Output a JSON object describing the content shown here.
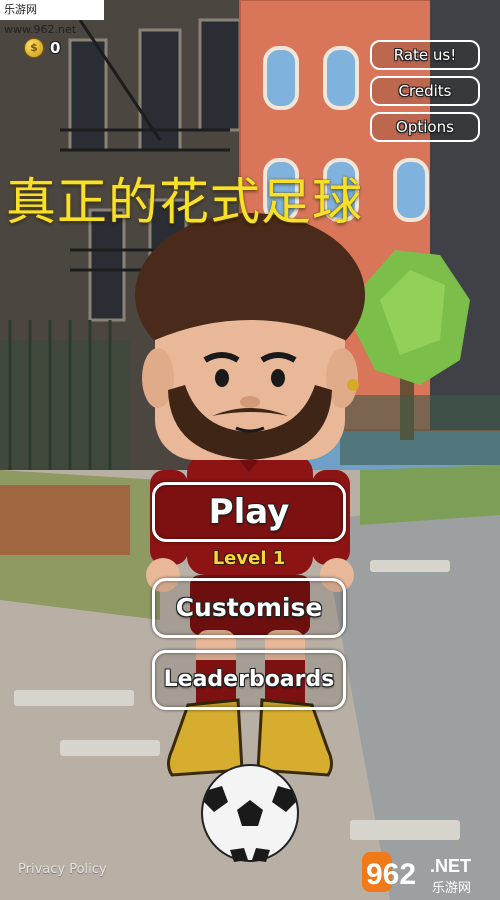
{
  "watermark": "乐游网 www.962.net",
  "coins": {
    "count": "0",
    "icon": "coin-icon"
  },
  "top_buttons": {
    "rate": "Rate us!",
    "credits": "Credits",
    "options": "Options"
  },
  "title": "真正的花式足球",
  "menu": {
    "play": "Play",
    "level": "Level 1",
    "customise": "Customise",
    "leaderboards": "Leaderboards"
  },
  "footer": {
    "privacy": "Privacy Policy"
  },
  "logo": {
    "number": "962",
    "domain": ".NET",
    "cn": "乐游网"
  },
  "colors": {
    "title": "#f7e02a",
    "level": "#f5d63c",
    "shirt": "#8c1414",
    "sky": "#6fa0c8"
  }
}
